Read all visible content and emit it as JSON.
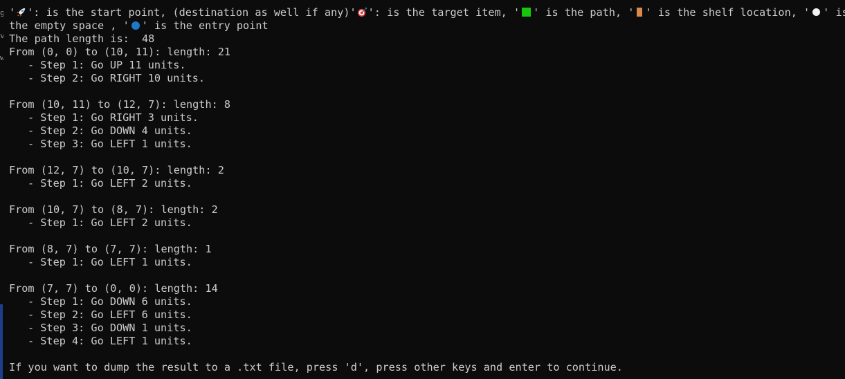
{
  "legend": {
    "q1": "'",
    "start_icon": "rocket-emoji",
    "start_text": "': is the start point, (destination as well if any)'",
    "target_icon": "target-emoji",
    "target_text": "': is the target item, '",
    "path_icon": "green-square",
    "path_text": "' is the path, '",
    "shelf_icon": "orange-block",
    "shelf_text": "' is the shelf location, '",
    "empty_icon": "white-circle",
    "empty_text": "' is",
    "line2_a": "the empty space , '",
    "entry_icon": "blue-circle",
    "entry_text": "' is the entry point"
  },
  "path_length_line": "The path length is:  48",
  "segments": [
    {
      "header": "From (0, 0) to (10, 11): length: 21",
      "steps": [
        "- Step 1: Go UP 11 units.",
        "- Step 2: Go RIGHT 10 units."
      ]
    },
    {
      "header": "From (10, 11) to (12, 7): length: 8",
      "steps": [
        "- Step 1: Go RIGHT 3 units.",
        "- Step 2: Go DOWN 4 units.",
        "- Step 3: Go LEFT 1 units."
      ]
    },
    {
      "header": "From (12, 7) to (10, 7): length: 2",
      "steps": [
        "- Step 1: Go LEFT 2 units."
      ]
    },
    {
      "header": "From (10, 7) to (8, 7): length: 2",
      "steps": [
        "- Step 1: Go LEFT 2 units."
      ]
    },
    {
      "header": "From (8, 7) to (7, 7): length: 1",
      "steps": [
        "- Step 1: Go LEFT 1 units."
      ]
    },
    {
      "header": "From (7, 7) to (0, 0): length: 14",
      "steps": [
        "- Step 1: Go DOWN 6 units.",
        "- Step 2: Go LEFT 6 units.",
        "- Step 3: Go DOWN 1 units.",
        "- Step 4: Go LEFT 1 units."
      ]
    }
  ],
  "prompt_line": "If you want to dump the result to a .txt file, press 'd', press other keys and enter to continue.",
  "edge_chars": [
    "g",
    "v",
    "w"
  ],
  "colors": {
    "background": "#0c0c0c",
    "foreground": "#cccccc",
    "path_green": "#16c60c",
    "shelf_orange": "#d98a4a",
    "entry_blue": "#1f78c8"
  }
}
